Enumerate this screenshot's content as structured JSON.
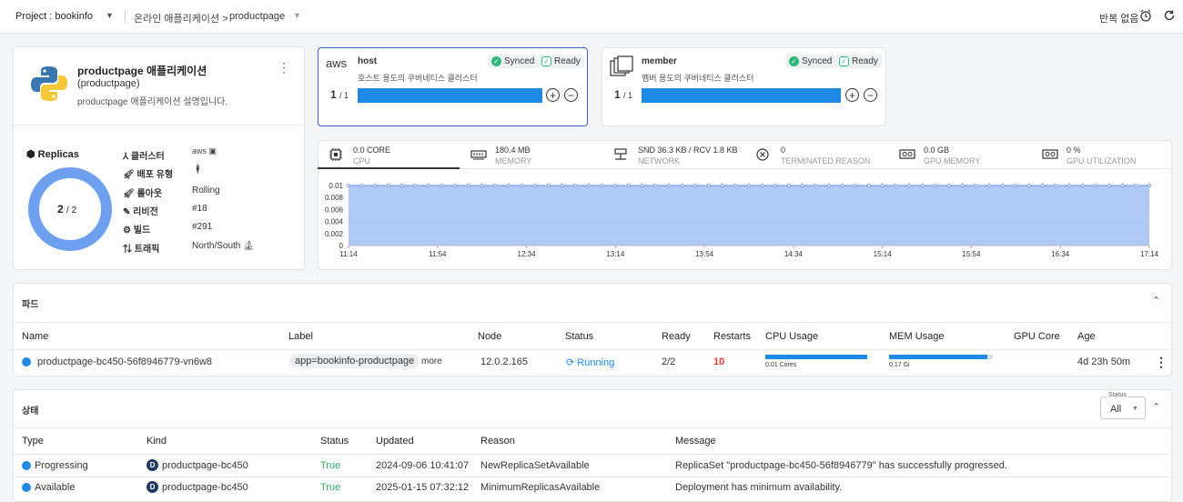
{
  "topbar": {
    "project_label": "Project : bookinfo",
    "breadcrumb_app": "온라인 애플리케이션",
    "breadcrumb_current": "productpage",
    "repeat_label": "반복 없음"
  },
  "app": {
    "title": "productpage 애플리케이션",
    "subtitle": "(productpage)",
    "description": "productpage 애플리케이션 설명입니다."
  },
  "replicas": {
    "heading": "Replicas",
    "current": "2",
    "total": "/ 2",
    "props": [
      {
        "label": "클러스터",
        "value": ""
      },
      {
        "label": "배포 유형",
        "value": ""
      },
      {
        "label": "롤아웃",
        "value": "Rolling"
      },
      {
        "label": "리비전",
        "value": "#18"
      },
      {
        "label": "빌드",
        "value": "#291"
      },
      {
        "label": "트래픽",
        "value": "North/South"
      }
    ]
  },
  "clusters": [
    {
      "name": "host",
      "desc": "호스트 용도의 쿠버네티스 클러스터",
      "count": "1",
      "total": "/ 1",
      "synced": "Synced",
      "ready": "Ready",
      "fill": 1.0
    },
    {
      "name": "member",
      "desc": "멤버 용도의 쿠버네티스 클러스터",
      "count": "1",
      "total": "/ 1",
      "synced": "Synced",
      "ready": "Ready",
      "fill": 1.0
    }
  ],
  "metric_tabs": [
    {
      "value": "0.0 CORE",
      "label": "CPU"
    },
    {
      "value": "180.4 MB",
      "label": "MEMORY"
    },
    {
      "value": "SND 36.3 KB / RCV 1.8 KB",
      "label": "NETWORK"
    },
    {
      "value": "0",
      "label": "TERMINATED REASON"
    },
    {
      "value": "0.0 GB",
      "label": "GPU MEMORY"
    },
    {
      "value": "0 %",
      "label": "GPU UTILIZATION"
    }
  ],
  "chart_data": {
    "type": "area",
    "x": [
      "11:14",
      "11:54",
      "12:34",
      "13:14",
      "13:54",
      "14:34",
      "15:14",
      "15:54",
      "16:34",
      "17:14"
    ],
    "y_ticks": [
      "0.01",
      "0.008",
      "0.006",
      "0.004",
      "0.002",
      "0"
    ],
    "ylim": [
      0,
      0.01
    ],
    "series": [
      {
        "values": [
          0.01,
          0.01,
          0.01,
          0.01,
          0.01,
          0.01,
          0.01,
          0.01,
          0.01,
          0.01
        ]
      }
    ],
    "fill_color": "#a9c3f5",
    "line_color": "#7da2ec",
    "grid": true
  },
  "pods": {
    "title": "파드",
    "columns": [
      "Name",
      "Label",
      "Node",
      "Status",
      "Ready",
      "Restarts",
      "CPU Usage",
      "MEM Usage",
      "GPU Core",
      "Age"
    ],
    "rows": [
      {
        "name": "productpage-bc450-56f8946779-vn6w8",
        "label": "app=bookinfo-productpage",
        "more": "more",
        "node": "12.0.2.165",
        "status": "Running",
        "ready": "2/2",
        "restarts": "10",
        "cpu_text": "0.01 Cores",
        "cpu_fill": 1.0,
        "mem_text": "0.17 Gi",
        "mem_fill": 0.95,
        "gpu": "",
        "age": "4d 23h 50m"
      }
    ]
  },
  "conditions": {
    "title": "상태",
    "filter_label": "Status",
    "filter_value": "All",
    "columns": [
      "Type",
      "Kind",
      "Status",
      "Updated",
      "Reason",
      "Message"
    ],
    "rows": [
      {
        "type": "Progressing",
        "kind_icon": "D",
        "kind": "productpage-bc450",
        "status": "True",
        "updated": "2024-09-06 10:41:07",
        "reason": "NewReplicaSetAvailable",
        "message": "ReplicaSet \"productpage-bc450-56f8946779\" has successfully progressed."
      },
      {
        "type": "Available",
        "kind_icon": "D",
        "kind": "productpage-bc450",
        "status": "True",
        "updated": "2025-01-15 07:32:12",
        "reason": "MinimumReplicasAvailable",
        "message": "Deployment has minimum availability."
      }
    ]
  },
  "colors": {
    "accent": "#1f8ae6",
    "success": "#2eb87a",
    "danger": "#e53935",
    "true_text": "#3aa66a"
  }
}
